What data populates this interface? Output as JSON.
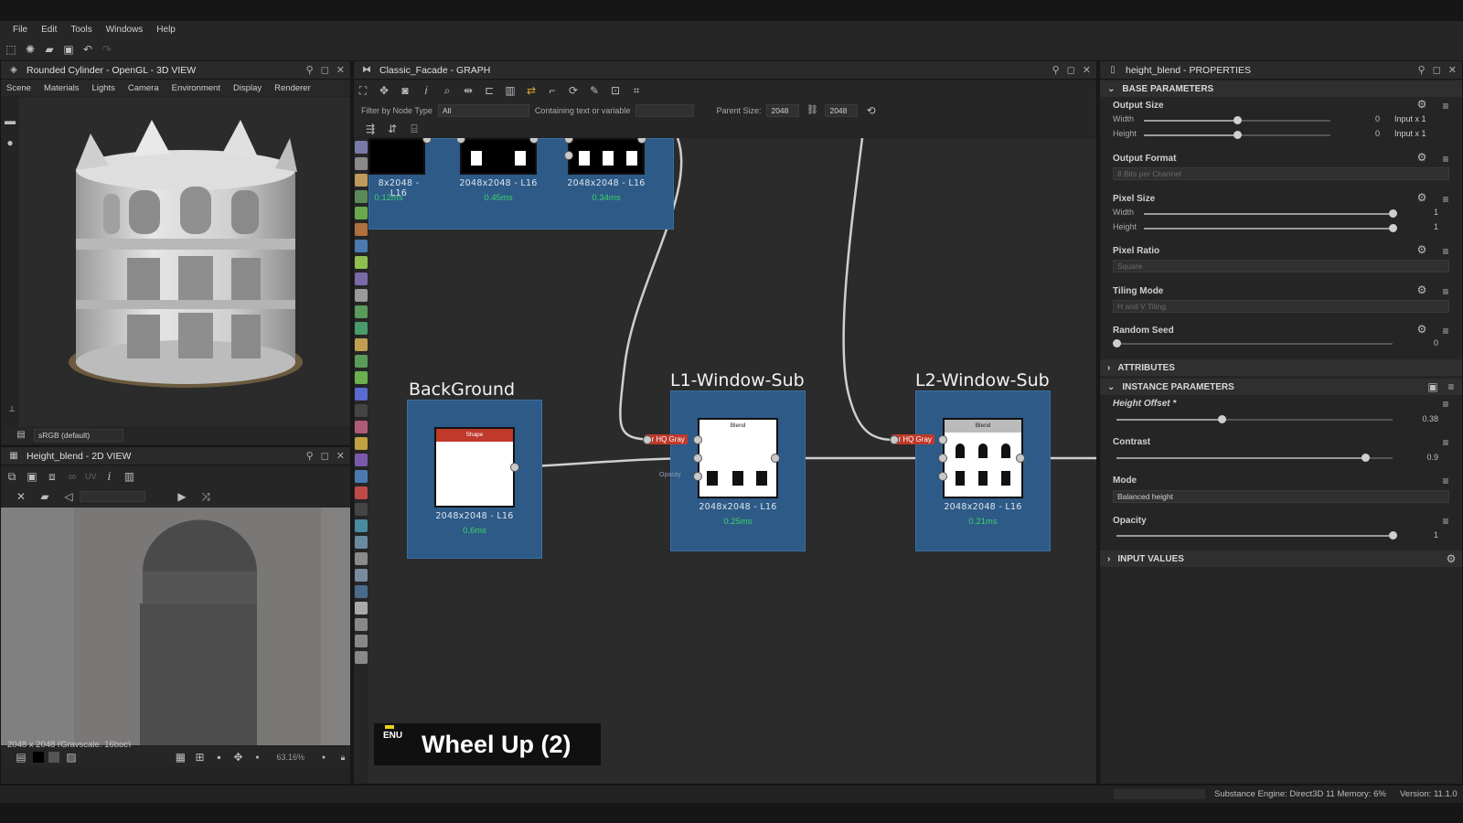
{
  "menu": [
    "File",
    "Edit",
    "Tools",
    "Windows",
    "Help"
  ],
  "view3d": {
    "title": "Rounded Cylinder - OpenGL - 3D VIEW",
    "tabs": [
      "Scene",
      "Materials",
      "Lights",
      "Camera",
      "Environment",
      "Display",
      "Renderer"
    ],
    "colorspace": "sRGB (default)"
  },
  "view2d": {
    "title": "Height_blend - 2D VIEW",
    "uv_label": "UV",
    "info": "2048 x 2048 (Grayscale, 16bpc)",
    "zoom": "63.16%"
  },
  "graph": {
    "title": "Classic_Facade - GRAPH",
    "filter_label": "Filter by Node Type",
    "filter_value": "All",
    "containing_label": "Containing text or variable",
    "parent_size_label": "Parent Size:",
    "parent_w": "2048",
    "parent_h": "2048",
    "top_nodes": [
      {
        "caption": "8x2048 - L16",
        "time": "0.12ms"
      },
      {
        "caption": "2048x2048 - L16",
        "time": "0.45ms"
      },
      {
        "caption": "2048x2048 - L16",
        "time": "0.34ms"
      }
    ],
    "frames": [
      {
        "title": "BackGround",
        "node_label": "Shape",
        "caption": "2048x2048 - L16",
        "time": "0.6ms"
      },
      {
        "title": "L1-Window-Sub",
        "node_label": "Blend",
        "caption": "2048x2048 - L16",
        "time": "0.25ms",
        "input": "ar HQ Gray",
        "opacity_label": "Opacity"
      },
      {
        "title": "L2-Window-Sub",
        "node_label": "Blend",
        "caption": "2048x2048 - L16",
        "time": "0.21ms",
        "input": "ar HQ Gray"
      }
    ],
    "keyhint": {
      "lang": "ENU",
      "text": "Wheel Up (2)"
    }
  },
  "properties": {
    "title": "height_blend - PROPERTIES",
    "sections": {
      "base": "BASE PARAMETERS",
      "attributes": "ATTRIBUTES",
      "instance": "INSTANCE PARAMETERS",
      "input": "INPUT VALUES"
    },
    "output_size": {
      "label": "Output Size",
      "width_label": "Width",
      "height_label": "Height",
      "width_val": "0",
      "height_val": "0",
      "width_mode": "Input x 1",
      "height_mode": "Input x 1",
      "width_level": 0.5,
      "height_level": 0.5
    },
    "output_format": {
      "label": "Output Format",
      "value": "8 Bits per Channel"
    },
    "pixel_size": {
      "label": "Pixel Size",
      "width_label": "Width",
      "height_label": "Height",
      "width_val": "1",
      "height_val": "1",
      "width_level": 1.0,
      "height_level": 1.0
    },
    "pixel_ratio": {
      "label": "Pixel Ratio",
      "value": "Square"
    },
    "tiling_mode": {
      "label": "Tiling Mode",
      "value": "H and V Tiling"
    },
    "random_seed": {
      "label": "Random Seed",
      "value": "0",
      "level": 0.0
    },
    "height_offset": {
      "label": "Height Offset *",
      "value": "0.38",
      "level": 0.38
    },
    "contrast": {
      "label": "Contrast",
      "value": "0.9",
      "level": 0.9
    },
    "mode": {
      "label": "Mode",
      "value": "Balanced height"
    },
    "opacity": {
      "label": "Opacity",
      "value": "1",
      "level": 1.0
    }
  },
  "status": {
    "engine": "Substance Engine: Direct3D 11 Memory: 6%",
    "version": "Version: 11.1.0"
  }
}
